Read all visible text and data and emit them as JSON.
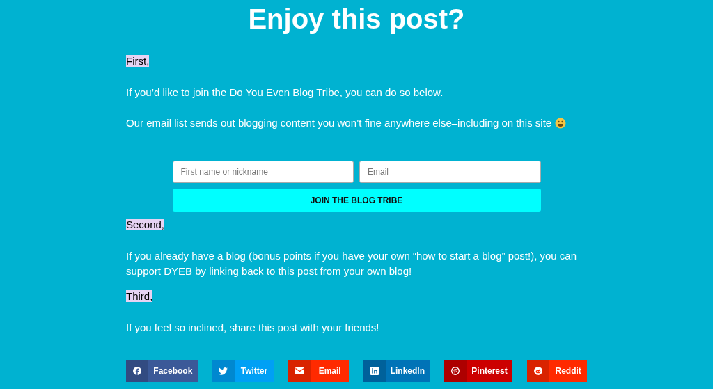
{
  "heading": "Enjoy this post?",
  "blocks": [
    {
      "kind": "label",
      "text": "First,"
    },
    {
      "kind": "text",
      "text": "If you’d like to join the Do You Even Blog Tribe, you can do so below."
    },
    {
      "kind": "text",
      "text": "Our email list sends out blogging content you won’t fine anywhere else–including on this site",
      "smiley": true
    },
    {
      "kind": "form",
      "name_placeholder": "First name or nickname",
      "email_placeholder": "Email",
      "button": "JOIN THE BLOG TRIBE"
    },
    {
      "kind": "label",
      "text": "Second,"
    },
    {
      "kind": "text",
      "text": "If you already have a blog (bonus points if you have your own “how to start a blog” post!), you can support DYEB by linking back to this post from your own blog!"
    },
    {
      "kind": "label",
      "text": "Third,"
    },
    {
      "kind": "text",
      "text": "If you feel so inclined, share this post with your friends!"
    }
  ],
  "share_buttons": [
    {
      "kind": "facebook",
      "label": "Facebook",
      "color": "#3b5998"
    },
    {
      "kind": "twitter",
      "label": "Twitter",
      "color": "#00a0f5"
    },
    {
      "kind": "email",
      "label": "Email",
      "color": "#ff2a00"
    },
    {
      "kind": "linkedin",
      "label": "LinkedIn",
      "color": "#0073b7"
    },
    {
      "kind": "pinterest",
      "label": "Pinterest",
      "color": "#cc0000"
    },
    {
      "kind": "reddit",
      "label": "Reddit",
      "color": "#ff2a00"
    }
  ]
}
